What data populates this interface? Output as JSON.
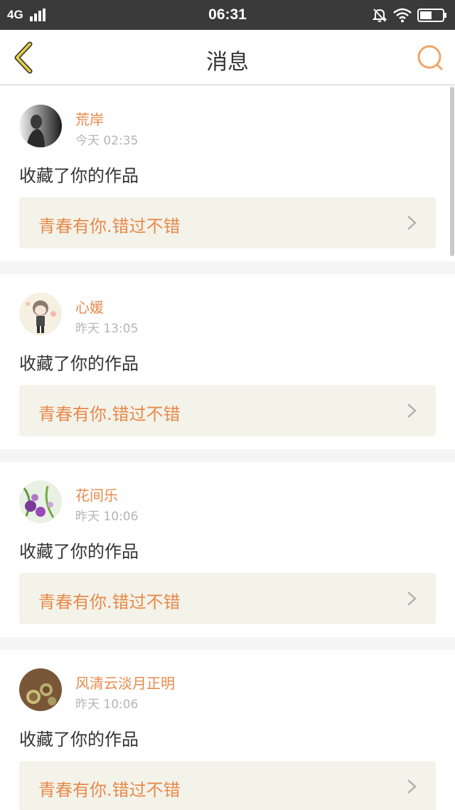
{
  "status_bar": {
    "network": "4G",
    "time": "06:31"
  },
  "header": {
    "title": "消息"
  },
  "colors": {
    "accent": "#e8894a",
    "back_icon": "#e8d23c",
    "search_icon": "#f0a468",
    "link_bg": "#f3f3ea"
  },
  "messages": [
    {
      "username": "荒岸",
      "time": "今天 02:35",
      "action": "收藏了你的作品",
      "work_title": "青春有你.错过不错"
    },
    {
      "username": "心媛",
      "time": "昨天 13:05",
      "action": "收藏了你的作品",
      "work_title": "青春有你.错过不错"
    },
    {
      "username": "花间乐",
      "time": "昨天 10:06",
      "action": "收藏了你的作品",
      "work_title": "青春有你.错过不错"
    },
    {
      "username": "风清云淡月正明",
      "time": "昨天 10:06",
      "action": "收藏了你的作品",
      "work_title": "青春有你.错过不错"
    }
  ]
}
